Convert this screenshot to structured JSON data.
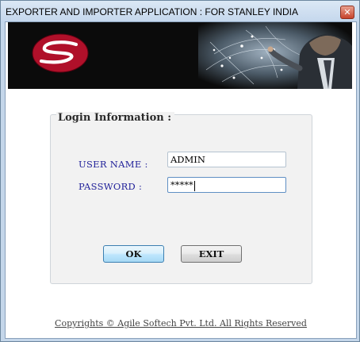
{
  "window": {
    "title": "EXPORTER AND IMPORTER APPLICATION : FOR STANLEY INDIA",
    "close_glyph": "✕"
  },
  "banner": {
    "logo_icon": "stanley-s-logo-icon",
    "image_icon": "businessman-world-network-image",
    "colors": {
      "background": "#0b0b0b",
      "logo_red": "#b0102a"
    }
  },
  "login": {
    "group_title": "Login Information :",
    "username_label": "USER NAME :",
    "username_value": "ADMIN",
    "password_label": "PASSWORD :",
    "password_value": "*****",
    "ok_label": "OK",
    "exit_label": "EXIT",
    "colors": {
      "label": "#22229a",
      "ok_button": "#bee6fd"
    }
  },
  "footer": {
    "copyright": "Copyrights © Agile Softech Pvt. Ltd. All Rights Reserved"
  }
}
